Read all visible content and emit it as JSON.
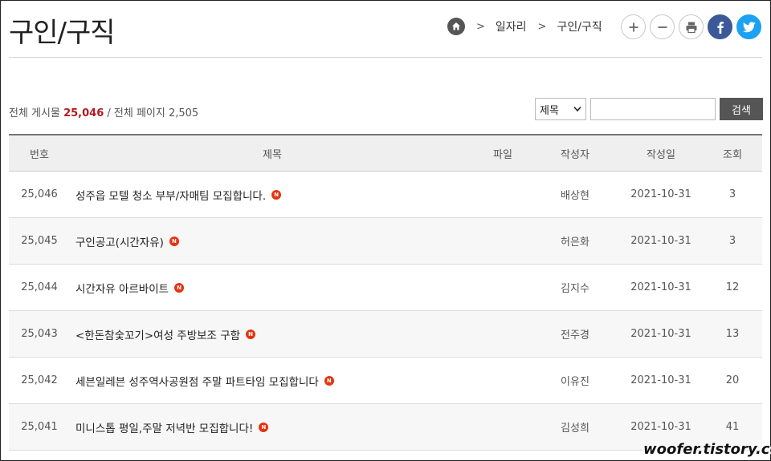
{
  "page": {
    "title": "구인/구직"
  },
  "breadcrumb": {
    "items": [
      "일자리",
      "구인/구직"
    ],
    "separator": ">"
  },
  "tools": [
    {
      "icon": "plus-icon",
      "label": "+"
    },
    {
      "icon": "minus-icon",
      "label": "−"
    },
    {
      "icon": "print-icon"
    },
    {
      "icon": "facebook-icon",
      "label": "f",
      "color": "#3b5998"
    },
    {
      "icon": "twitter-icon",
      "color": "#1da1f2"
    }
  ],
  "stats": {
    "total_label": "전체 게시물",
    "total_count": "25,046",
    "pages_label": "/ 전체 페이지",
    "pages_count": "2,505"
  },
  "search": {
    "field_selected": "제목",
    "query": "",
    "button_label": "검색"
  },
  "table": {
    "headers": {
      "num": "번호",
      "title": "제목",
      "file": "파일",
      "author": "작성자",
      "date": "작성일",
      "views": "조회"
    },
    "new_badge": "N",
    "rows": [
      {
        "num": "25,046",
        "title": "성주읍 모텔 청소 부부/자매팀 모집합니다.",
        "author": "배상현",
        "date": "2021-10-31",
        "views": "3"
      },
      {
        "num": "25,045",
        "title": "구인공고(시간자유)",
        "author": "허은화",
        "date": "2021-10-31",
        "views": "3"
      },
      {
        "num": "25,044",
        "title": "시간자유 아르바이트",
        "author": "김지수",
        "date": "2021-10-31",
        "views": "12"
      },
      {
        "num": "25,043",
        "title": "<한돈참숯꼬기>여성 주방보조 구함",
        "author": "전주경",
        "date": "2021-10-31",
        "views": "13"
      },
      {
        "num": "25,042",
        "title": "세븐일레븐 성주역사공원점 주말 파트타임 모집합니다",
        "author": "이유진",
        "date": "2021-10-31",
        "views": "20"
      },
      {
        "num": "25,041",
        "title": "미니스톱 평일,주말 저녁반 모집합니다!",
        "author": "김성희",
        "date": "2021-10-31",
        "views": "41"
      }
    ]
  },
  "watermark": "woofer.tistory.com"
}
